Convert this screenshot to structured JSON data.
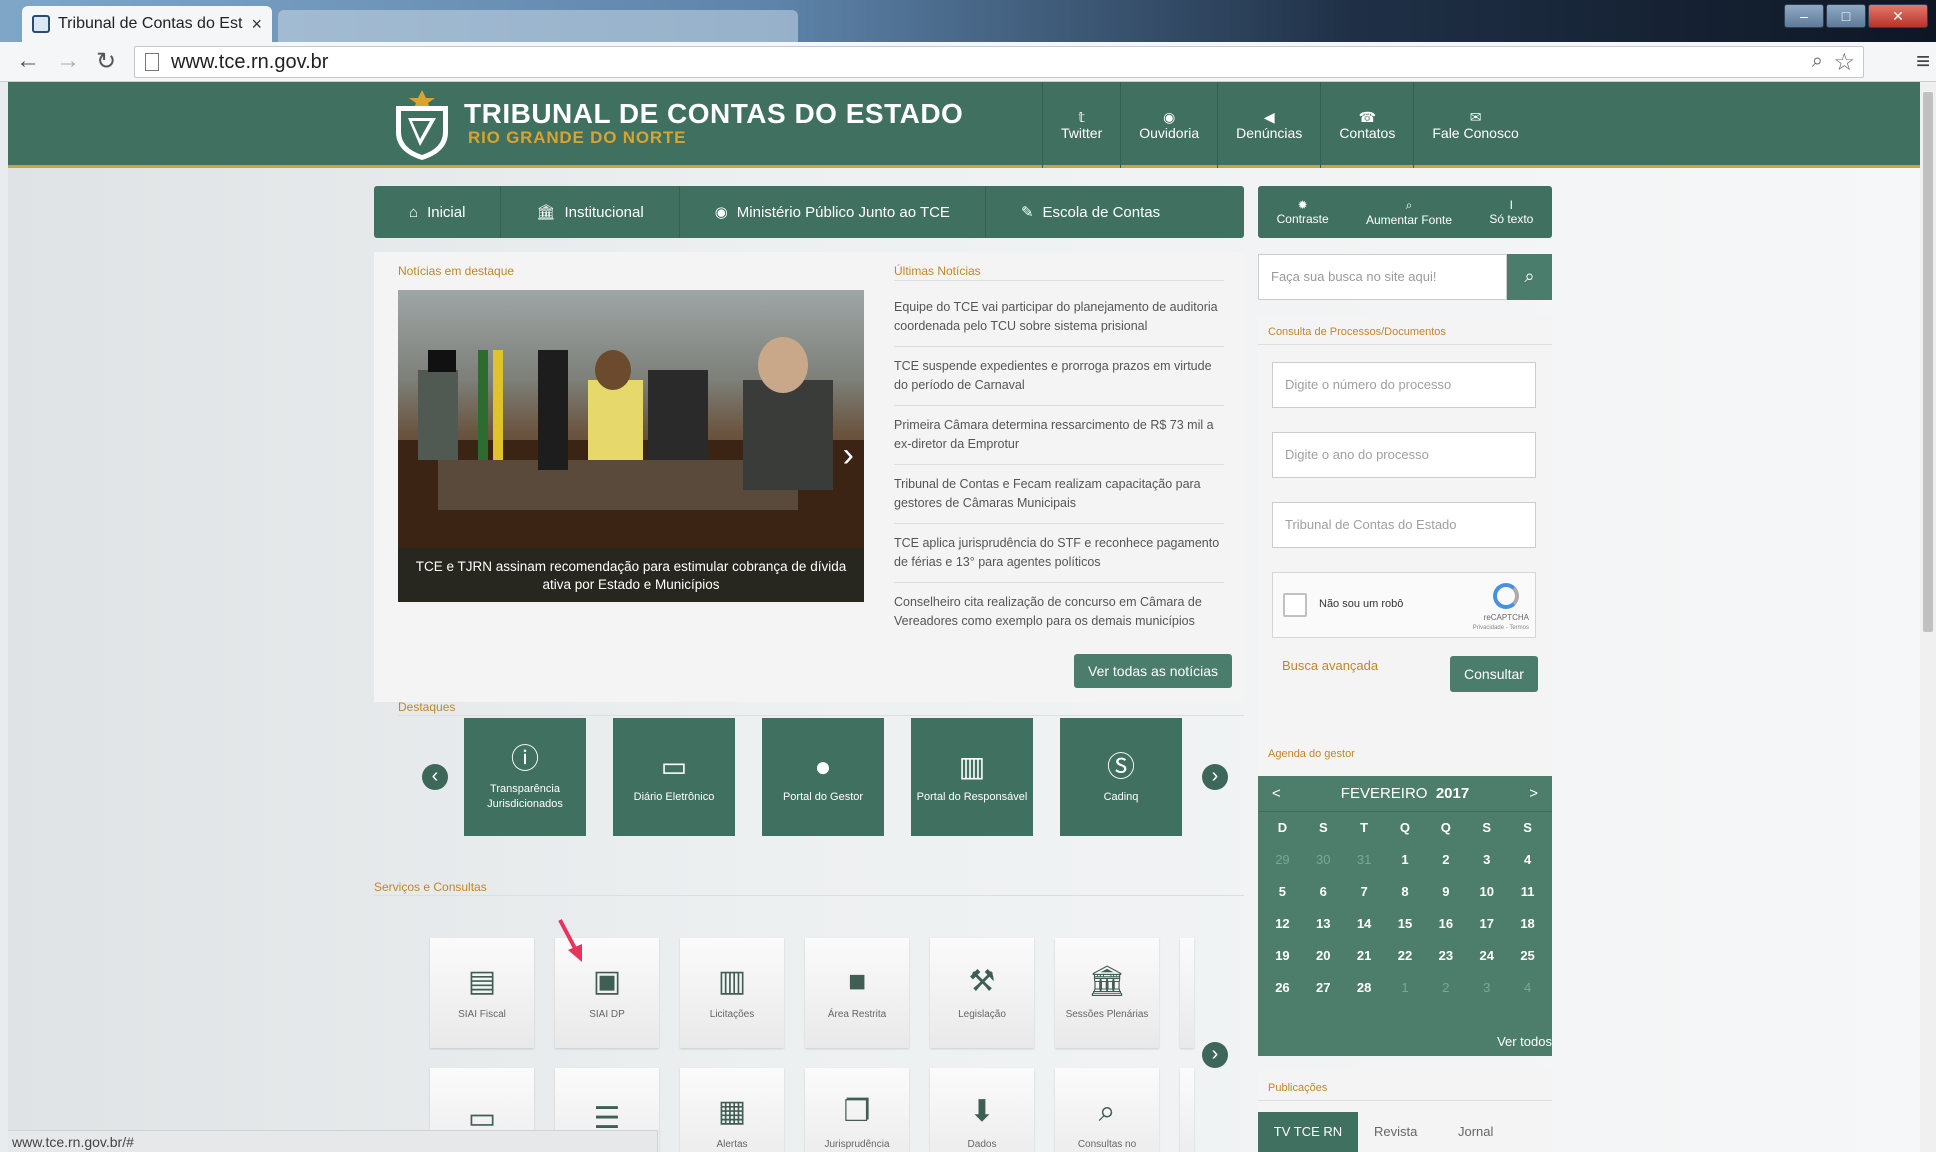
{
  "browser": {
    "tab_title": "Tribunal de Contas do Est",
    "tab_close": "×",
    "url": "www.tce.rn.gov.br",
    "status_url": "www.tce.rn.gov.br/#"
  },
  "header": {
    "brand_line1": "TRIBUNAL DE CONTAS DO ESTADO",
    "brand_line2": "RIO GRANDE DO NORTE",
    "links": [
      {
        "label": "Twitter",
        "icon": "twitter-icon"
      },
      {
        "label": "Ouvidoria",
        "icon": "chat-icon"
      },
      {
        "label": "Denúncias",
        "icon": "megaphone-icon"
      },
      {
        "label": "Contatos",
        "icon": "phone-icon"
      },
      {
        "label": "Fale Conosco",
        "icon": "mail-icon"
      }
    ]
  },
  "menu": {
    "items": [
      {
        "label": "Inicial",
        "icon": "home-icon"
      },
      {
        "label": "Institucional",
        "icon": "bank-icon"
      },
      {
        "label": "Ministério Público Junto ao TCE",
        "icon": "eye-icon"
      },
      {
        "label": "Escola de Contas",
        "icon": "pencil-icon"
      }
    ]
  },
  "accessibility": [
    {
      "label": "Contraste",
      "icon": "contrast-icon"
    },
    {
      "label": "Aumentar Fonte",
      "icon": "zoom-icon"
    },
    {
      "label": "Só texto",
      "icon": "text-icon"
    }
  ],
  "news": {
    "featured_heading": "Notícias em destaque",
    "featured_caption": "TCE e TJRN assinam recomendação para estimular cobrança de dívida ativa por Estado e Municípios",
    "latest_heading": "Últimas Notícias",
    "items": [
      "Equipe do TCE vai participar do planejamento de auditoria coordenada pelo TCU sobre sistema prisional",
      "TCE suspende expedientes e prorroga prazos em virtude do período de Carnaval",
      "Primeira Câmara determina ressarcimento de R$ 73 mil a ex-diretor da Emprotur",
      "Tribunal de Contas e Fecam realizam capacitação para gestores de Câmaras Municipais",
      "TCE aplica jurisprudência do STF e reconhece pagamento de férias e 13° para agentes políticos",
      "Conselheiro cita realização de concurso em Câmara de Vereadores como exemplo para os demais municípios"
    ],
    "see_all": "Ver todas as notícias"
  },
  "highlights": {
    "heading": "Destaques",
    "tiles": [
      {
        "label": "Transparência Jurisdicionados",
        "icon": "info-icon"
      },
      {
        "label": "Diário Eletrônico",
        "icon": "monitor-icon"
      },
      {
        "label": "Portal do Gestor",
        "icon": "user-icon"
      },
      {
        "label": "Portal do Responsável",
        "icon": "barcode-icon"
      },
      {
        "label": "Cadinq",
        "icon": "money-icon"
      }
    ]
  },
  "services": {
    "heading": "Serviços e Consultas",
    "row1": [
      {
        "label": "SIAI Fiscal",
        "icon": "document-icon"
      },
      {
        "label": "SIAI DP",
        "icon": "clipboard-icon"
      },
      {
        "label": "Licitações",
        "icon": "books-icon"
      },
      {
        "label": "Área Restrita",
        "icon": "lock-icon"
      },
      {
        "label": "Legislação",
        "icon": "gavel-icon"
      },
      {
        "label": "Sessões Plenárias",
        "icon": "building-icon"
      }
    ],
    "row2": [
      {
        "label": "",
        "icon": "inbox-icon"
      },
      {
        "label": "",
        "icon": "list-icon"
      },
      {
        "label": "Alertas",
        "icon": "newspaper-icon"
      },
      {
        "label": "Jurisprudência",
        "icon": "copy-icon"
      },
      {
        "label": "Dados",
        "icon": "download-box-icon"
      },
      {
        "label": "Consultas no",
        "icon": "search-icon"
      }
    ]
  },
  "sidebar": {
    "search_placeholder": "Faça sua busca no site aqui!",
    "process_heading": "Consulta de Processos/Documentos",
    "process_number_placeholder": "Digite o número do processo",
    "process_year_placeholder": "Digite o ano do processo",
    "process_org_placeholder": "Tribunal de Contas do Estado",
    "captcha_label": "Não sou um robô",
    "captcha_brand": "reCAPTCHA",
    "captcha_links": "Privacidade - Termos",
    "advanced_search": "Busca avançada",
    "submit": "Consultar",
    "agenda_heading": "Agenda do gestor",
    "calendar": {
      "prev": "<",
      "next": ">",
      "month": "FEVEREIRO",
      "year": "2017",
      "weekdays": [
        "D",
        "S",
        "T",
        "Q",
        "Q",
        "S",
        "S"
      ],
      "days": [
        "29",
        "30",
        "31",
        "1",
        "2",
        "3",
        "4",
        "5",
        "6",
        "7",
        "8",
        "9",
        "10",
        "11",
        "12",
        "13",
        "14",
        "15",
        "16",
        "17",
        "18",
        "19",
        "20",
        "21",
        "22",
        "23",
        "24",
        "25",
        "26",
        "27",
        "28",
        "1",
        "2",
        "3",
        "4"
      ],
      "see_all": "Ver todos"
    },
    "publications_heading": "Publicações",
    "pub_tabs": [
      "TV TCE RN",
      "Revista",
      "Jornal"
    ]
  }
}
